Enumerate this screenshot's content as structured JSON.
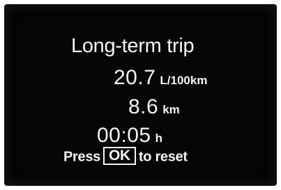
{
  "display": {
    "title": "Long-term trip",
    "consumption": {
      "value": "20.7",
      "unit": "L/100km"
    },
    "distance": {
      "value": "8.6",
      "unit": "km"
    },
    "time": {
      "value": "00:05",
      "unit": "h"
    },
    "reset_prompt": {
      "before": "Press",
      "key": "OK",
      "after": "to reset"
    }
  },
  "colors": {
    "screen_background": "#050505",
    "text": "#f4f4f4",
    "frame": "#ffffff"
  }
}
